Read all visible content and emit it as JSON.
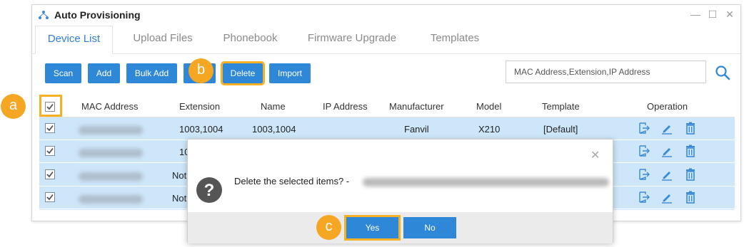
{
  "window": {
    "title": "Auto Provisioning",
    "controls": {
      "minimize": "—",
      "maximize": "☐",
      "close": "✕"
    }
  },
  "tabs": [
    {
      "label": "Device List"
    },
    {
      "label": "Upload Files"
    },
    {
      "label": "Phonebook"
    },
    {
      "label": "Firmware Upgrade"
    },
    {
      "label": "Templates"
    }
  ],
  "toolbar": {
    "scan_label": "Scan",
    "add_label": "Add",
    "bulk_add_label": "Bulk Add",
    "delete_label": "Delete",
    "import_label": "Import"
  },
  "search": {
    "placeholder": "MAC Address,Extension,IP Address",
    "icon": "search-icon"
  },
  "table": {
    "columns": [
      "MAC Address",
      "Extension",
      "Name",
      "IP Address",
      "Manufacturer",
      "Model",
      "Template",
      "Operation"
    ],
    "rows": [
      {
        "extension": "1003,1004",
        "name": "1003,1004",
        "ip": "",
        "manufacturer": "Fanvil",
        "model": "X210",
        "template": "[Default]"
      },
      {
        "extension": "10",
        "name": "",
        "ip": "",
        "manufacturer": "",
        "model": "",
        "template": ""
      },
      {
        "extension": "Not",
        "name": "",
        "ip": "",
        "manufacturer": "",
        "model": "",
        "template": ""
      },
      {
        "extension": "Not",
        "name": "",
        "ip": "",
        "manufacturer": "",
        "model": "",
        "template": ""
      }
    ]
  },
  "callouts": {
    "a": "a",
    "b": "b",
    "c": "c"
  },
  "dialog": {
    "message": "Delete the selected items? -",
    "yes_label": "Yes",
    "no_label": "No",
    "close": "✕"
  },
  "colors": {
    "accent": "#2f87d8",
    "highlight": "#f5b024",
    "row_selected": "#cde6f9"
  }
}
